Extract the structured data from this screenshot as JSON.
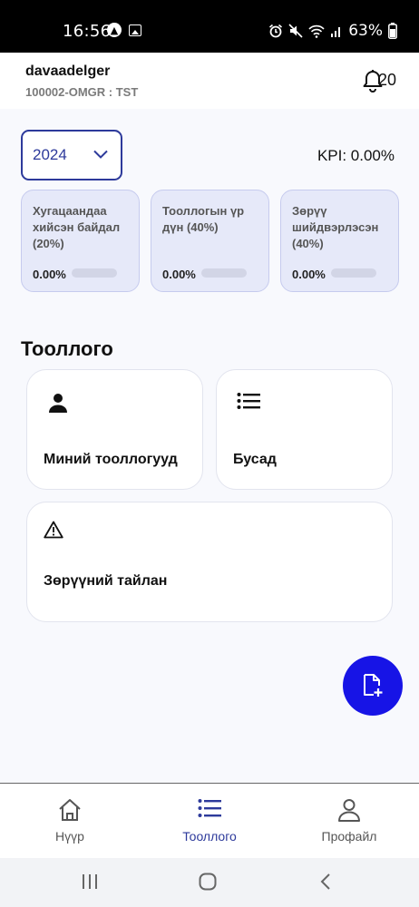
{
  "status_bar": {
    "time": "16:56",
    "battery": "63%",
    "icons": [
      "nav-app-icon",
      "gallery-icon",
      "alarm-icon",
      "mute-icon",
      "wifi-icon",
      "signal-icon",
      "battery-icon"
    ]
  },
  "header": {
    "user_name": "davaadelger",
    "user_code": "100002-OMGR : TST",
    "notification_count": "20"
  },
  "filters": {
    "year": "2024",
    "kpi": "KPI: 0.00%"
  },
  "kpi_cards": [
    {
      "label": "Хугацаандаа хийсэн байдал (20%)",
      "value": "0.00%",
      "progress": 0
    },
    {
      "label": "Тооллогын үр дүн (40%)",
      "value": "0.00%",
      "progress": 0
    },
    {
      "label": "Зөрүү шийдвэрлэсэн (40%)",
      "value": "0.00%",
      "progress": 0
    }
  ],
  "section": {
    "title": "Тооллого"
  },
  "menu": {
    "my_counts": "Миний тооллогууд",
    "others": "Бусад",
    "variance_report": "Зөрүүний тайлан"
  },
  "bottom_nav": [
    {
      "label": "Нүүр",
      "icon": "home-icon",
      "active": false
    },
    {
      "label": "Тооллого",
      "icon": "list-icon",
      "active": true
    },
    {
      "label": "Профайл",
      "icon": "profile-icon",
      "active": false
    }
  ],
  "colors": {
    "accent": "#2d3a9b",
    "fab": "#1714e6",
    "card_bg": "#e6e9f9"
  }
}
